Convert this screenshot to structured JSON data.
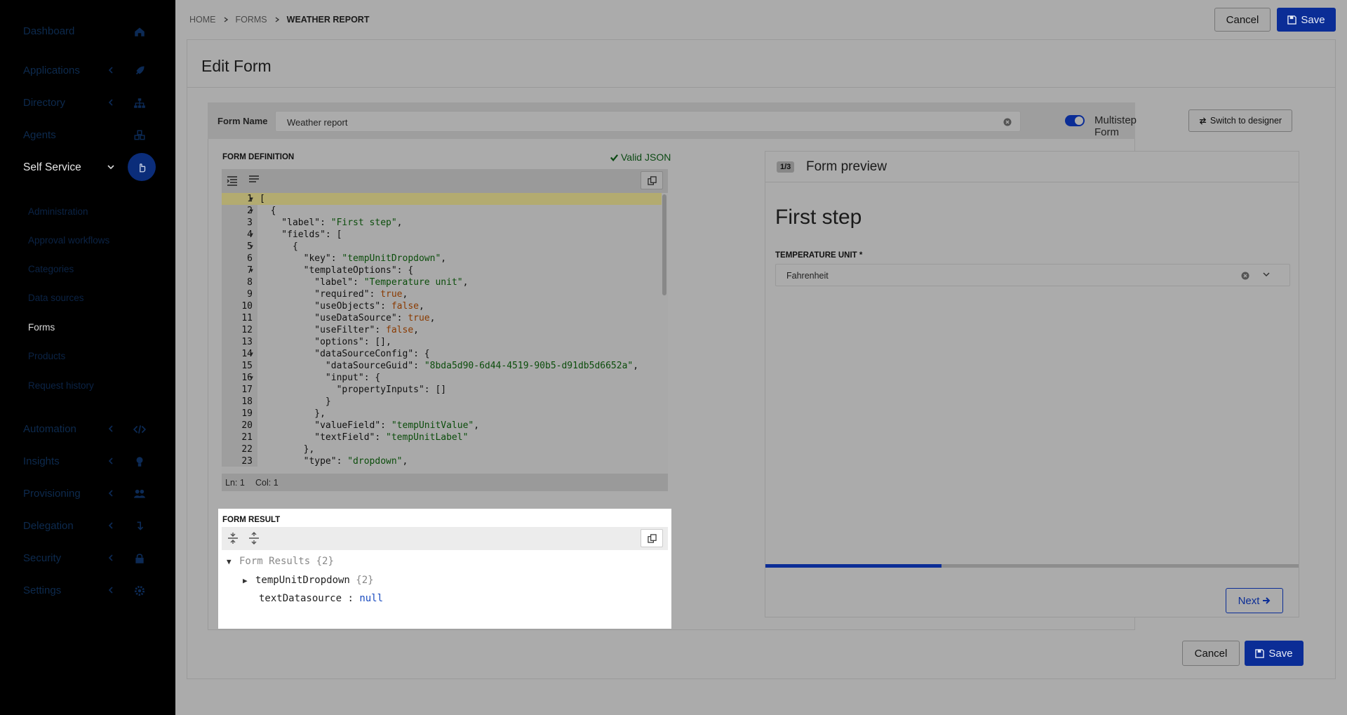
{
  "sidebar": {
    "items": [
      {
        "label": "Dashboard",
        "icon": "home-icon"
      },
      {
        "label": "Applications",
        "icon": "rocket-icon"
      },
      {
        "label": "Directory",
        "icon": "sitemap-icon"
      },
      {
        "label": "Agents",
        "icon": "cubes-icon"
      },
      {
        "label": "Self Service",
        "icon": "hand-pointer-icon"
      },
      {
        "label": "Automation",
        "icon": "code-icon"
      },
      {
        "label": "Insights",
        "icon": "lightbulb-icon"
      },
      {
        "label": "Provisioning",
        "icon": "users-icon"
      },
      {
        "label": "Delegation",
        "icon": "arrow-turn-icon"
      },
      {
        "label": "Security",
        "icon": "lock-icon"
      },
      {
        "label": "Settings",
        "icon": "gear-icon"
      }
    ],
    "self_service_sub": [
      "Administration",
      "Approval workflows",
      "Categories",
      "Data sources",
      "Forms",
      "Products",
      "Request history"
    ]
  },
  "breadcrumb": {
    "home": "HOME",
    "forms": "FORMS",
    "current": "WEATHER REPORT"
  },
  "header": {
    "cancel_label": "Cancel",
    "save_label": "Save"
  },
  "page_title": "Edit Form",
  "form": {
    "name_label": "Form Name",
    "name_value": "Weather report",
    "multistep_label": "Multistep Form",
    "multistep_on": true,
    "switch_label": "Switch to designer"
  },
  "definition": {
    "title": "FORM DEFINITION",
    "valid_label": "Valid JSON",
    "status_ln": "Ln: 1",
    "status_col": "Col: 1"
  },
  "result": {
    "title": "FORM RESULT",
    "root_label": "Form Results",
    "root_count": "{2}",
    "item1_key": "tempUnitDropdown",
    "item1_count": "{2}",
    "item2_key": "textDatasource",
    "item2_sep": ":",
    "item2_value": "null"
  },
  "preview": {
    "step_badge": "1/3",
    "title": "Form preview",
    "step_heading": "First step",
    "field_label": "TEMPERATURE UNIT *",
    "field_value": "Fahrenheit",
    "progress": 0.33,
    "next_label": "Next"
  },
  "footer": {
    "cancel_label": "Cancel",
    "save_label": "Save"
  },
  "colors": {
    "accent": "#0b2d96",
    "valid": "#0c4a14",
    "string": "#0b4d0b",
    "boolean": "#8a3a00"
  }
}
